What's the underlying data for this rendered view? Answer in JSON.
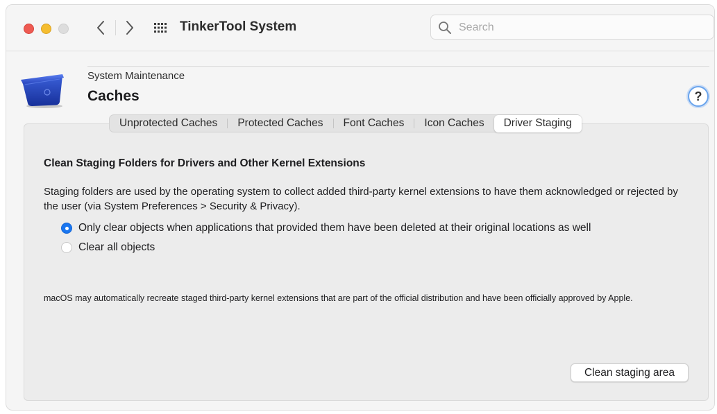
{
  "window": {
    "app_title": "TinkerTool System",
    "search_placeholder": "Search"
  },
  "pane": {
    "subtitle": "System Maintenance",
    "title": "Caches",
    "help_label": "?"
  },
  "tabs": [
    {
      "label": "Unprotected Caches",
      "selected": false
    },
    {
      "label": "Protected Caches",
      "selected": false
    },
    {
      "label": "Font Caches",
      "selected": false
    },
    {
      "label": "Icon Caches",
      "selected": false
    },
    {
      "label": "Driver Staging",
      "selected": true
    }
  ],
  "content": {
    "heading": "Clean Staging Folders for Drivers and Other Kernel Extensions",
    "description": "Staging folders are used by the operating system to collect added third-party kernel extensions to have them acknowledged or rejected by the user (via System Preferences > Security & Privacy).",
    "options": [
      {
        "label": "Only clear objects when applications that provided them have been deleted at their original locations as well",
        "selected": true
      },
      {
        "label": "Clear all objects",
        "selected": false
      }
    ],
    "note": "macOS may automatically recreate staged third-party kernel extensions that are part of the official distribution and have been officially approved by Apple.",
    "action_label": "Clean staging area"
  },
  "colors": {
    "accent": "#1a76f0",
    "close": "#ee5a52",
    "minimize": "#f5bd2f",
    "inactive": "#dddddd",
    "pane_icon": "#1f3fb0"
  },
  "icons": {
    "back": "chevron-left-icon",
    "forward": "chevron-right-icon",
    "grid": "grid-icon",
    "search": "search-icon",
    "pane": "blue-bin-icon"
  }
}
